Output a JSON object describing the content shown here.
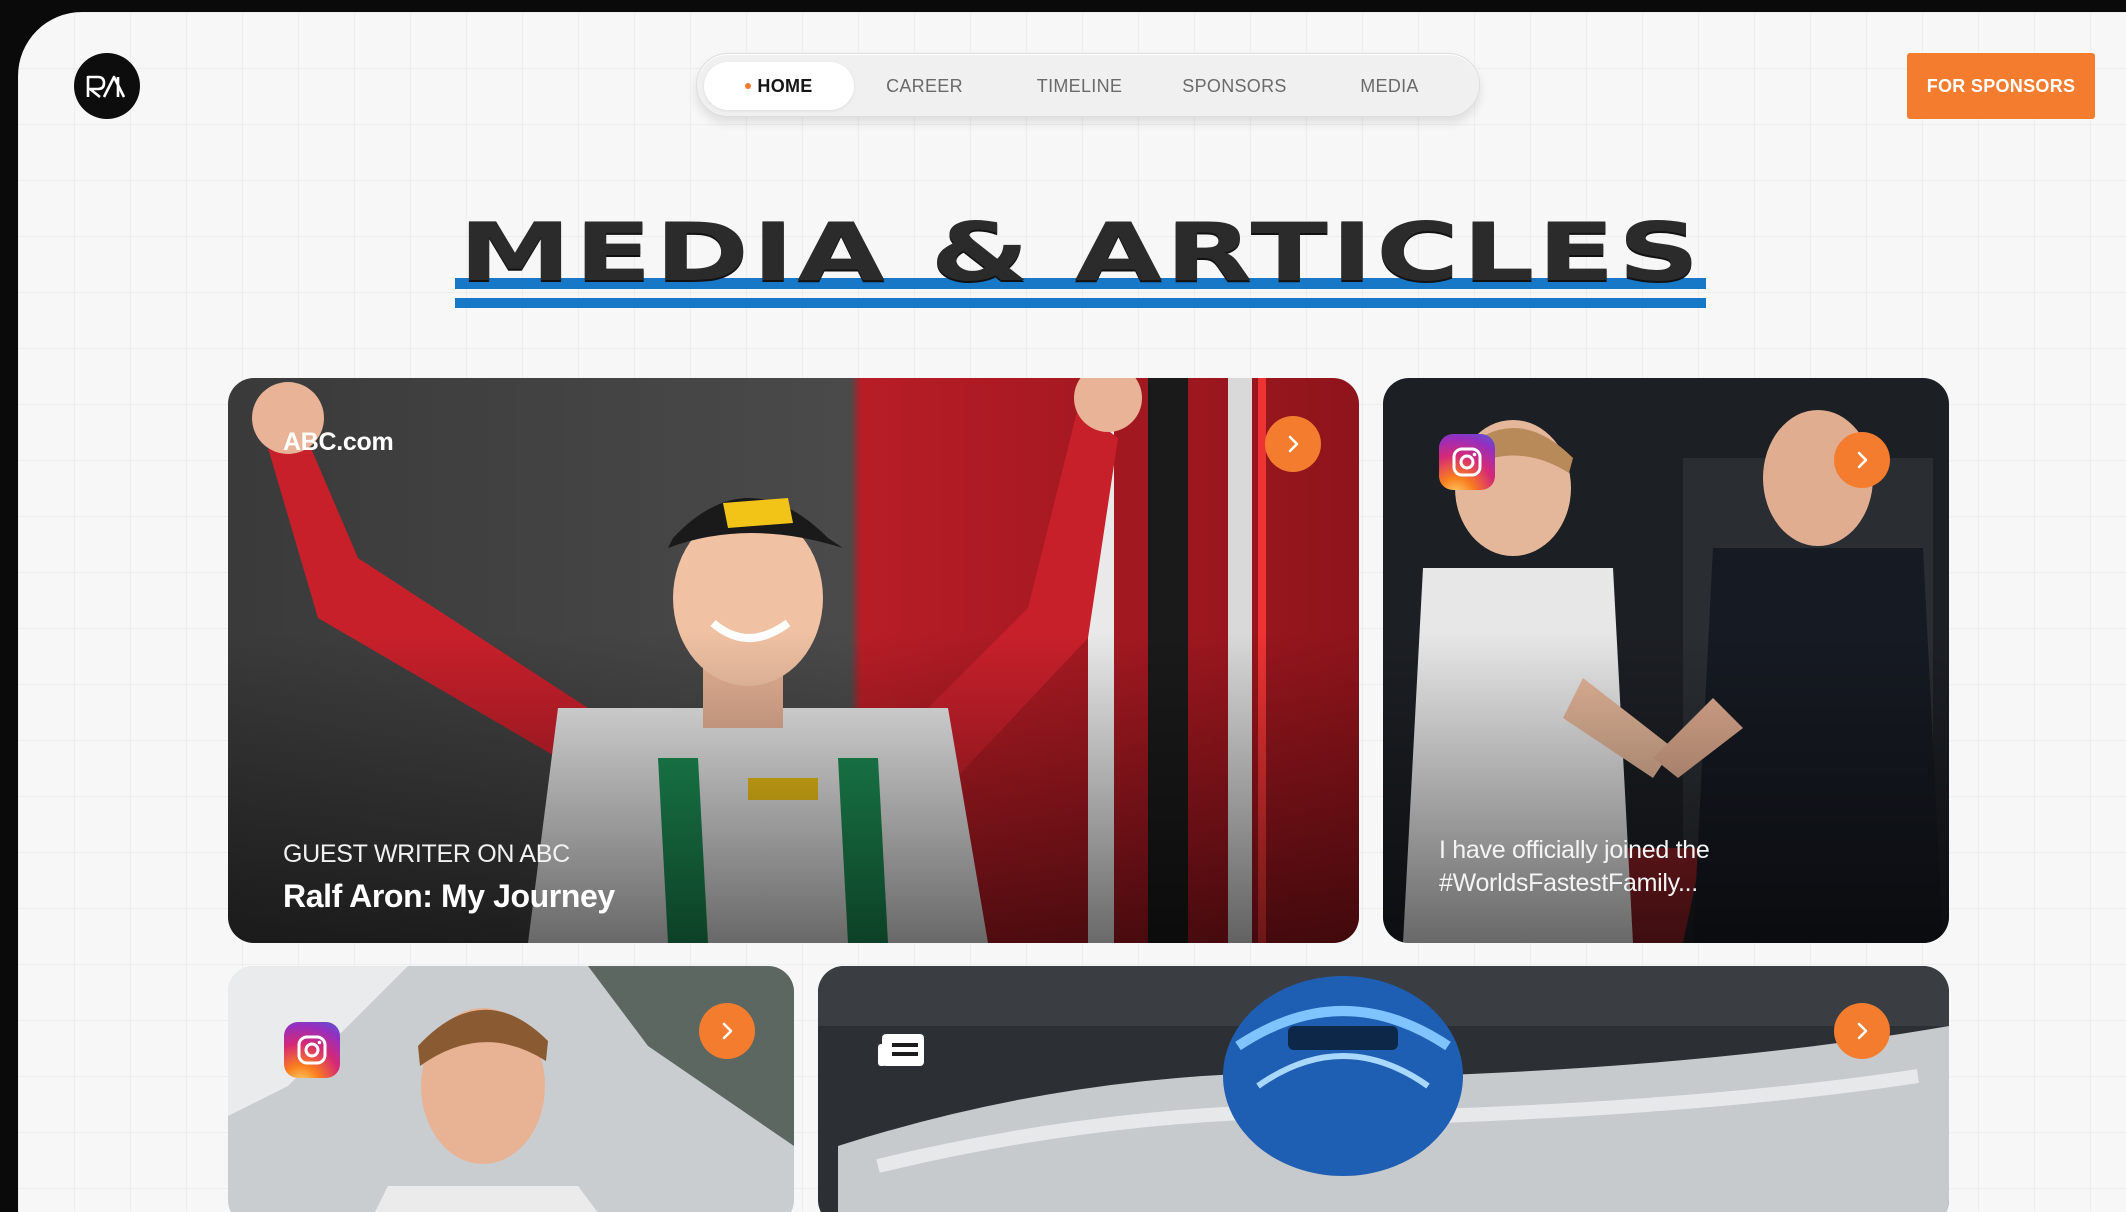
{
  "header": {
    "logo_text": "RA",
    "nav": [
      {
        "label": "HOME",
        "active": true
      },
      {
        "label": "CAREER",
        "active": false
      },
      {
        "label": "TIMELINE",
        "active": false
      },
      {
        "label": "SPONSORS",
        "active": false
      },
      {
        "label": "MEDIA",
        "active": false
      }
    ],
    "cta_label": "FOR SPONSORS"
  },
  "section": {
    "title": "MEDIA & ARTICLES"
  },
  "cards": [
    {
      "type": "article",
      "source": "ABC.com",
      "kicker": "GUEST WRITER ON ABC",
      "headline": "Ralf Aron: My Journey",
      "icon": "chevron-right-icon"
    },
    {
      "type": "instagram",
      "caption_line1": "I have officially joined the",
      "caption_line2": "#WorldsFastestFamily...",
      "icon": "instagram-icon"
    },
    {
      "type": "instagram",
      "icon": "instagram-icon"
    },
    {
      "type": "article",
      "icon": "article-icon"
    }
  ],
  "colors": {
    "accent": "#f47c2f",
    "stripe": "#1778c7",
    "background": "#f7f7f7"
  }
}
